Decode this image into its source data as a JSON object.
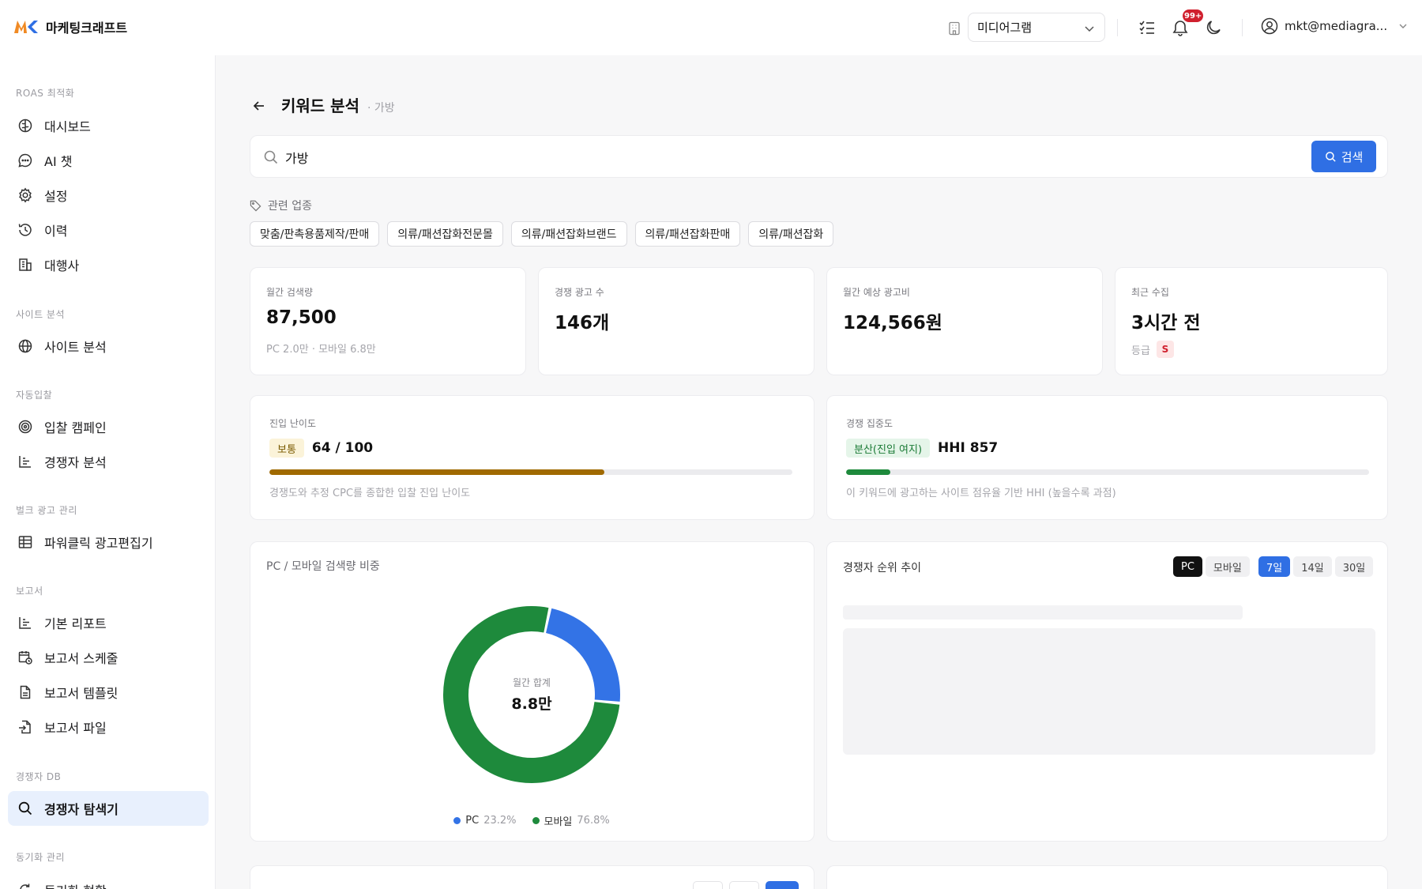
{
  "app": {
    "brand": "마케팅크래프트"
  },
  "header": {
    "org_select": "미디어그램",
    "notif_count": "99+",
    "user_email": "mkt@mediagra..."
  },
  "sidebar": {
    "sections": [
      {
        "title": "ROAS 최적화",
        "items": [
          "대시보드",
          "AI 챗",
          "설정",
          "이력",
          "대행사"
        ]
      },
      {
        "title": "사이트 분석",
        "items": [
          "사이트 분석"
        ]
      },
      {
        "title": "자동입찰",
        "items": [
          "입찰 캠페인",
          "경쟁자 분석"
        ]
      },
      {
        "title": "벌크 광고 관리",
        "items": [
          "파워클릭 광고편집기"
        ]
      },
      {
        "title": "보고서",
        "items": [
          "기본 리포트",
          "보고서 스케줄",
          "보고서 템플릿",
          "보고서 파일"
        ]
      },
      {
        "title": "경쟁자 DB",
        "items": [
          "경쟁자 탐색기"
        ]
      },
      {
        "title": "동기화 관리",
        "items": [
          "동기화 현황"
        ]
      }
    ],
    "active_item": "경쟁자 탐색기"
  },
  "page": {
    "title": "키워드 분석",
    "subtitle": "· 가방",
    "search_value": "가방",
    "search_button": "검색",
    "industry_label": "관련 업종",
    "industries": [
      "맞춤/판촉용품제작/판매",
      "의류/패션잡화전문몰",
      "의류/패션잡화브랜드",
      "의류/패션잡화판매",
      "의류/패션잡화"
    ]
  },
  "stats": [
    {
      "label": "월간 검색량",
      "value": "87,500",
      "sub": "PC 2.0만 · 모바일 6.8만"
    },
    {
      "label": "경쟁 광고 수",
      "value": "146개",
      "sub": ""
    },
    {
      "label": "월간 예상 광고비",
      "value": "124,566원",
      "sub": ""
    },
    {
      "label": "최근 수집",
      "value": "3시간 전",
      "sub": "등급",
      "grade": "S"
    }
  ],
  "difficulty": {
    "label": "진입 난이도",
    "level": "보통",
    "value_text": "64 / 100",
    "score": 64,
    "max": 100,
    "color": "#a06a00",
    "desc": "경쟁도와 추정 CPC를 종합한 입찰 진입 난이도"
  },
  "concentration": {
    "label": "경쟁 집중도",
    "level": "분산(진입 여지)",
    "value_text": "HHI 857",
    "fill_fraction": 0.085,
    "color": "#1e8a3c",
    "desc": "이 키워드에 광고하는 사이트 점유율 기반 HHI (높을수록 과점)"
  },
  "chart_data": {
    "type": "pie",
    "title": "PC / 모바일 검색량 비중",
    "center_label": "월간 합계",
    "center_value": "8.8만",
    "categories": [
      "PC",
      "모바일"
    ],
    "values": [
      23.2,
      76.8
    ],
    "value_labels": [
      "23.2%",
      "76.8%"
    ],
    "colors": [
      "#3373e6",
      "#1e8a3c"
    ]
  },
  "rank_trend": {
    "title": "경쟁자 순위 추이",
    "device_tabs": [
      "PC",
      "모바일"
    ],
    "device_active": "PC",
    "range_tabs": [
      "7일",
      "14일",
      "30일"
    ],
    "range_active": "7일"
  }
}
